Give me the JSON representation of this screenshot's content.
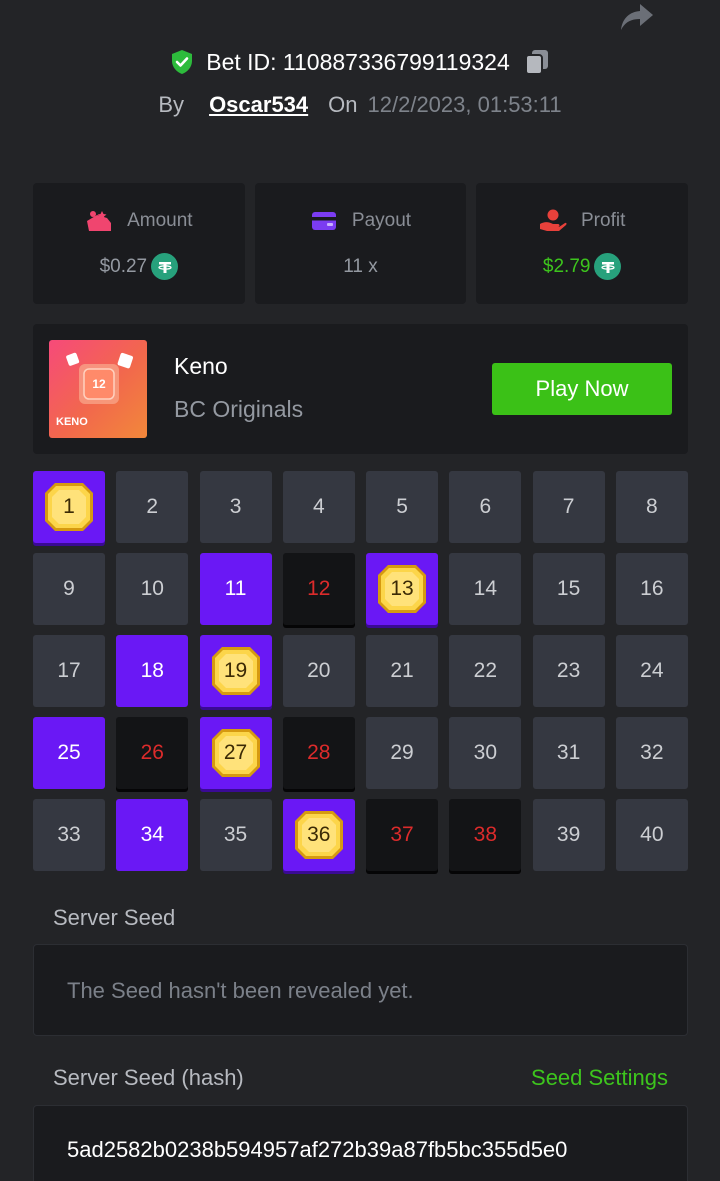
{
  "header": {
    "bet_id": "Bet ID: 110887336799119324",
    "by_label": "By",
    "username": "Oscar534",
    "on_label": "On",
    "timestamp": "12/2/2023, 01:53:11"
  },
  "stats": [
    {
      "label": "Amount",
      "value": "$0.27",
      "icon": "wallet-icon"
    },
    {
      "label": "Payout",
      "value": "11 x",
      "icon": "card-icon"
    },
    {
      "label": "Profit",
      "value": "$2.79",
      "icon": "hand-coin-icon"
    }
  ],
  "game": {
    "title": "Keno",
    "subtitle": "BC Originals",
    "thumb_label": "KENO",
    "thumb_number": "12",
    "play_label": "Play Now"
  },
  "grid": [
    {
      "n": "1",
      "state": "hit"
    },
    {
      "n": "2",
      "state": "normal"
    },
    {
      "n": "3",
      "state": "normal"
    },
    {
      "n": "4",
      "state": "normal"
    },
    {
      "n": "5",
      "state": "normal"
    },
    {
      "n": "6",
      "state": "normal"
    },
    {
      "n": "7",
      "state": "normal"
    },
    {
      "n": "8",
      "state": "normal"
    },
    {
      "n": "9",
      "state": "normal"
    },
    {
      "n": "10",
      "state": "normal"
    },
    {
      "n": "11",
      "state": "picked"
    },
    {
      "n": "12",
      "state": "miss"
    },
    {
      "n": "13",
      "state": "hit"
    },
    {
      "n": "14",
      "state": "normal"
    },
    {
      "n": "15",
      "state": "normal"
    },
    {
      "n": "16",
      "state": "normal"
    },
    {
      "n": "17",
      "state": "normal"
    },
    {
      "n": "18",
      "state": "picked"
    },
    {
      "n": "19",
      "state": "hit"
    },
    {
      "n": "20",
      "state": "normal"
    },
    {
      "n": "21",
      "state": "normal"
    },
    {
      "n": "22",
      "state": "normal"
    },
    {
      "n": "23",
      "state": "normal"
    },
    {
      "n": "24",
      "state": "normal"
    },
    {
      "n": "25",
      "state": "picked"
    },
    {
      "n": "26",
      "state": "miss"
    },
    {
      "n": "27",
      "state": "hit"
    },
    {
      "n": "28",
      "state": "miss"
    },
    {
      "n": "29",
      "state": "normal"
    },
    {
      "n": "30",
      "state": "normal"
    },
    {
      "n": "31",
      "state": "normal"
    },
    {
      "n": "32",
      "state": "normal"
    },
    {
      "n": "33",
      "state": "normal"
    },
    {
      "n": "34",
      "state": "picked"
    },
    {
      "n": "35",
      "state": "normal"
    },
    {
      "n": "36",
      "state": "hit"
    },
    {
      "n": "37",
      "state": "miss"
    },
    {
      "n": "38",
      "state": "miss"
    },
    {
      "n": "39",
      "state": "normal"
    },
    {
      "n": "40",
      "state": "normal"
    }
  ],
  "server_seed": {
    "label": "Server Seed",
    "message": "The Seed hasn't been revealed yet."
  },
  "server_seed_hash": {
    "label": "Server Seed (hash)",
    "settings_label": "Seed Settings",
    "value": "5ad2582b0238b594957af272b39a87fb5bc355d5e0"
  },
  "colors": {
    "accent_green": "#3bc117",
    "picked_purple": "#6a18f5",
    "miss_red": "#dc2b2b",
    "background": "#232427"
  }
}
